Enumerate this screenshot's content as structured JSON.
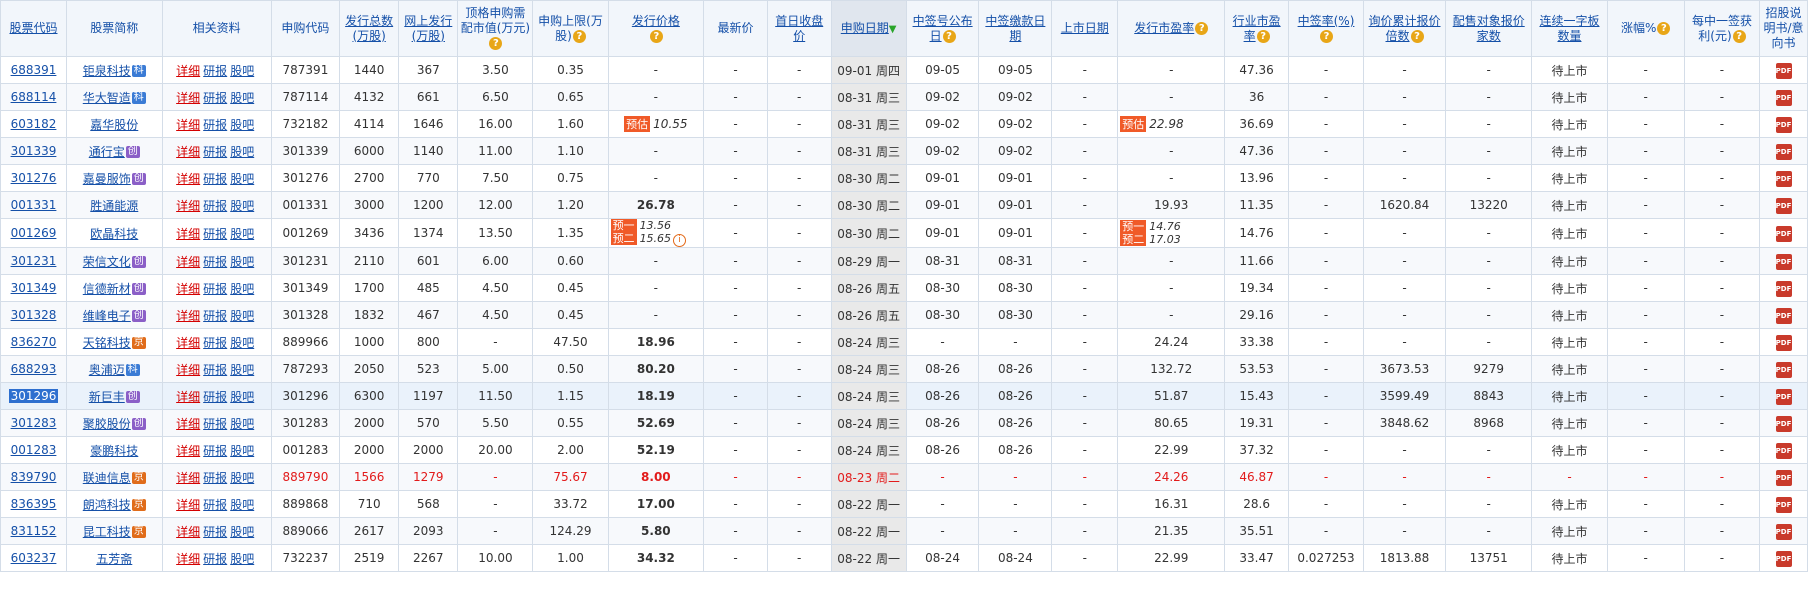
{
  "headers": {
    "code": "股票代码",
    "name": "股票简称",
    "related": "相关资料",
    "sub_code": "申购代码",
    "total_issue": "发行总数(万股)",
    "online_issue": "网上发行(万股)",
    "top_mv": "顶格申购需配市值(万元)",
    "sub_limit": "申购上限(万股)",
    "issue_price": "发行价格",
    "latest_price": "最新价",
    "first_close": "首日收盘价",
    "sub_date": "申购日期",
    "lot_date": "中签号公布日",
    "pay_date": "中签缴款日期",
    "list_date": "上市日期",
    "issue_pe": "发行市盈率",
    "industry_pe": "行业市盈率",
    "win_rate": "中签率(%)",
    "inquiry_multiple": "询价累计报价倍数",
    "alloc_count": "配售对象报价家数",
    "limit_boards": "连续一字板数量",
    "change_pct": "涨幅%",
    "profit_per": "每中一签获利(元)",
    "prospectus": "招股说明书/意向书"
  },
  "links": {
    "detail": "详细",
    "report": "研报",
    "forum": "股吧"
  },
  "badges": {
    "ke": "科",
    "chuang": "创",
    "jing": "京"
  },
  "pdf_label": "PDF",
  "rows": [
    {
      "code": "688391",
      "name": "钜泉科技",
      "badge": "ke",
      "sub_code": "787391",
      "total": "1440",
      "online": "367",
      "top_mv": "3.50",
      "limit": "0.35",
      "price": "-",
      "latest": "-",
      "first": "-",
      "date": "09-01 周四",
      "lot": "09-05",
      "pay": "09-05",
      "list": "-",
      "issue_pe": "-",
      "ind_pe": "47.36",
      "rate": "-",
      "inq": "-",
      "alloc": "-",
      "boards": "待上市",
      "chg": "-",
      "profit": "-"
    },
    {
      "code": "688114",
      "name": "华大智造",
      "badge": "ke",
      "sub_code": "787114",
      "total": "4132",
      "online": "661",
      "top_mv": "6.50",
      "limit": "0.65",
      "price": "-",
      "latest": "-",
      "first": "-",
      "date": "08-31 周三",
      "lot": "09-02",
      "pay": "09-02",
      "list": "-",
      "issue_pe": "-",
      "ind_pe": "36",
      "rate": "-",
      "inq": "-",
      "alloc": "-",
      "boards": "待上市",
      "chg": "-",
      "profit": "-"
    },
    {
      "code": "603182",
      "name": "嘉华股份",
      "badge": "",
      "sub_code": "732182",
      "total": "4114",
      "online": "1646",
      "top_mv": "16.00",
      "limit": "1.60",
      "price": "10.55",
      "price_tag": "预估",
      "latest": "-",
      "first": "-",
      "date": "08-31 周三",
      "lot": "09-02",
      "pay": "09-02",
      "list": "-",
      "issue_pe": "22.98",
      "issue_pe_tag": "预估",
      "ind_pe": "36.69",
      "rate": "-",
      "inq": "-",
      "alloc": "-",
      "boards": "待上市",
      "chg": "-",
      "profit": "-"
    },
    {
      "code": "301339",
      "name": "通行宝",
      "badge": "chuang",
      "sub_code": "301339",
      "total": "6000",
      "online": "1140",
      "top_mv": "11.00",
      "limit": "1.10",
      "price": "-",
      "latest": "-",
      "first": "-",
      "date": "08-31 周三",
      "lot": "09-02",
      "pay": "09-02",
      "list": "-",
      "issue_pe": "-",
      "ind_pe": "47.36",
      "rate": "-",
      "inq": "-",
      "alloc": "-",
      "boards": "待上市",
      "chg": "-",
      "profit": "-"
    },
    {
      "code": "301276",
      "name": "嘉曼服饰",
      "badge": "chuang",
      "sub_code": "301276",
      "total": "2700",
      "online": "770",
      "top_mv": "7.50",
      "limit": "0.75",
      "price": "-",
      "latest": "-",
      "first": "-",
      "date": "08-30 周二",
      "lot": "09-01",
      "pay": "09-01",
      "list": "-",
      "issue_pe": "-",
      "ind_pe": "13.96",
      "rate": "-",
      "inq": "-",
      "alloc": "-",
      "boards": "待上市",
      "chg": "-",
      "profit": "-"
    },
    {
      "code": "001331",
      "name": "胜通能源",
      "badge": "",
      "sub_code": "001331",
      "total": "3000",
      "online": "1200",
      "top_mv": "12.00",
      "limit": "1.20",
      "price": "26.78",
      "price_bold": true,
      "latest": "-",
      "first": "-",
      "date": "08-30 周二",
      "lot": "09-01",
      "pay": "09-01",
      "list": "-",
      "issue_pe": "19.93",
      "ind_pe": "11.35",
      "rate": "-",
      "inq": "1620.84",
      "alloc": "13220",
      "boards": "待上市",
      "chg": "-",
      "profit": "-"
    },
    {
      "code": "001269",
      "name": "欧晶科技",
      "badge": "",
      "sub_code": "001269",
      "total": "3436",
      "online": "1374",
      "top_mv": "13.50",
      "limit": "1.35",
      "price": "",
      "price_multi": [
        "13.56",
        "15.65"
      ],
      "price_tags": [
        "预一",
        "预二"
      ],
      "latest": "-",
      "first": "-",
      "date": "08-30 周二",
      "lot": "09-01",
      "pay": "09-01",
      "list": "-",
      "issue_pe": "",
      "issue_pe_multi": [
        "14.76",
        "17.03"
      ],
      "ind_pe": "14.76",
      "rate": "-",
      "inq": "-",
      "alloc": "-",
      "boards": "待上市",
      "chg": "-",
      "profit": "-"
    },
    {
      "code": "301231",
      "name": "荣信文化",
      "badge": "chuang",
      "sub_code": "301231",
      "total": "2110",
      "online": "601",
      "top_mv": "6.00",
      "limit": "0.60",
      "price": "-",
      "latest": "-",
      "first": "-",
      "date": "08-29 周一",
      "lot": "08-31",
      "pay": "08-31",
      "list": "-",
      "issue_pe": "-",
      "ind_pe": "11.66",
      "rate": "-",
      "inq": "-",
      "alloc": "-",
      "boards": "待上市",
      "chg": "-",
      "profit": "-"
    },
    {
      "code": "301349",
      "name": "信德新材",
      "badge": "chuang",
      "sub_code": "301349",
      "total": "1700",
      "online": "485",
      "top_mv": "4.50",
      "limit": "0.45",
      "price": "-",
      "latest": "-",
      "first": "-",
      "date": "08-26 周五",
      "lot": "08-30",
      "pay": "08-30",
      "list": "-",
      "issue_pe": "-",
      "ind_pe": "19.34",
      "rate": "-",
      "inq": "-",
      "alloc": "-",
      "boards": "待上市",
      "chg": "-",
      "profit": "-"
    },
    {
      "code": "301328",
      "name": "维峰电子",
      "badge": "chuang",
      "sub_code": "301328",
      "total": "1832",
      "online": "467",
      "top_mv": "4.50",
      "limit": "0.45",
      "price": "-",
      "latest": "-",
      "first": "-",
      "date": "08-26 周五",
      "lot": "08-30",
      "pay": "08-30",
      "list": "-",
      "issue_pe": "-",
      "ind_pe": "29.16",
      "rate": "-",
      "inq": "-",
      "alloc": "-",
      "boards": "待上市",
      "chg": "-",
      "profit": "-"
    },
    {
      "code": "836270",
      "name": "天铭科技",
      "badge": "jing",
      "sub_code": "889966",
      "total": "1000",
      "online": "800",
      "top_mv": "-",
      "limit": "47.50",
      "price": "18.96",
      "price_bold": true,
      "latest": "-",
      "first": "-",
      "date": "08-24 周三",
      "lot": "-",
      "pay": "-",
      "list": "-",
      "issue_pe": "24.24",
      "ind_pe": "33.38",
      "rate": "-",
      "inq": "-",
      "alloc": "-",
      "boards": "待上市",
      "chg": "-",
      "profit": "-"
    },
    {
      "code": "688293",
      "name": "奥浦迈",
      "badge": "ke",
      "sub_code": "787293",
      "total": "2050",
      "online": "523",
      "top_mv": "5.00",
      "limit": "0.50",
      "price": "80.20",
      "price_bold": true,
      "latest": "-",
      "first": "-",
      "date": "08-24 周三",
      "lot": "08-26",
      "pay": "08-26",
      "list": "-",
      "issue_pe": "132.72",
      "ind_pe": "53.53",
      "rate": "-",
      "inq": "3673.53",
      "alloc": "9279",
      "boards": "待上市",
      "chg": "-",
      "profit": "-"
    },
    {
      "code": "301296",
      "name": "新巨丰",
      "badge": "chuang",
      "selected": true,
      "sub_code": "301296",
      "total": "6300",
      "online": "1197",
      "top_mv": "11.50",
      "limit": "1.15",
      "price": "18.19",
      "price_bold": true,
      "latest": "-",
      "first": "-",
      "date": "08-24 周三",
      "lot": "08-26",
      "pay": "08-26",
      "list": "-",
      "issue_pe": "51.87",
      "ind_pe": "15.43",
      "rate": "-",
      "inq": "3599.49",
      "alloc": "8843",
      "boards": "待上市",
      "chg": "-",
      "profit": "-"
    },
    {
      "code": "301283",
      "name": "聚胶股份",
      "badge": "chuang",
      "sub_code": "301283",
      "total": "2000",
      "online": "570",
      "top_mv": "5.50",
      "limit": "0.55",
      "price": "52.69",
      "price_bold": true,
      "latest": "-",
      "first": "-",
      "date": "08-24 周三",
      "lot": "08-26",
      "pay": "08-26",
      "list": "-",
      "issue_pe": "80.65",
      "ind_pe": "19.31",
      "rate": "-",
      "inq": "3848.62",
      "alloc": "8968",
      "boards": "待上市",
      "chg": "-",
      "profit": "-"
    },
    {
      "code": "001283",
      "name": "豪鹏科技",
      "badge": "",
      "sub_code": "001283",
      "total": "2000",
      "online": "2000",
      "top_mv": "20.00",
      "limit": "2.00",
      "price": "52.19",
      "price_bold": true,
      "latest": "-",
      "first": "-",
      "date": "08-24 周三",
      "lot": "08-26",
      "pay": "08-26",
      "list": "-",
      "issue_pe": "22.99",
      "ind_pe": "37.32",
      "rate": "-",
      "inq": "-",
      "alloc": "-",
      "boards": "待上市",
      "chg": "-",
      "profit": "-"
    },
    {
      "code": "839790",
      "name": "联迪信息",
      "badge": "jing",
      "red": true,
      "sub_code": "889790",
      "total": "1566",
      "online": "1279",
      "top_mv": "-",
      "limit": "75.67",
      "price": "8.00",
      "price_bold": true,
      "latest": "-",
      "first": "-",
      "date": "08-23 周二",
      "lot": "-",
      "pay": "-",
      "list": "-",
      "issue_pe": "24.26",
      "ind_pe": "46.87",
      "rate": "-",
      "inq": "-",
      "alloc": "-",
      "boards": "-",
      "chg": "-",
      "profit": "-"
    },
    {
      "code": "836395",
      "name": "朗鸿科技",
      "badge": "jing",
      "sub_code": "889868",
      "total": "710",
      "online": "568",
      "top_mv": "-",
      "limit": "33.72",
      "price": "17.00",
      "price_bold": true,
      "latest": "-",
      "first": "-",
      "date": "08-22 周一",
      "lot": "-",
      "pay": "-",
      "list": "-",
      "issue_pe": "16.31",
      "ind_pe": "28.6",
      "rate": "-",
      "inq": "-",
      "alloc": "-",
      "boards": "待上市",
      "chg": "-",
      "profit": "-"
    },
    {
      "code": "831152",
      "name": "昆工科技",
      "badge": "jing",
      "sub_code": "889066",
      "total": "2617",
      "online": "2093",
      "top_mv": "-",
      "limit": "124.29",
      "price": "5.80",
      "price_bold": true,
      "latest": "-",
      "first": "-",
      "date": "08-22 周一",
      "lot": "-",
      "pay": "-",
      "list": "-",
      "issue_pe": "21.35",
      "ind_pe": "35.51",
      "rate": "-",
      "inq": "-",
      "alloc": "-",
      "boards": "待上市",
      "chg": "-",
      "profit": "-"
    },
    {
      "code": "603237",
      "name": "五芳斋",
      "badge": "",
      "sub_code": "732237",
      "total": "2519",
      "online": "2267",
      "top_mv": "10.00",
      "limit": "1.00",
      "price": "34.32",
      "price_bold": true,
      "latest": "-",
      "first": "-",
      "date": "08-22 周一",
      "lot": "08-24",
      "pay": "08-24",
      "list": "-",
      "issue_pe": "22.99",
      "ind_pe": "33.47",
      "rate": "0.027253",
      "inq": "1813.88",
      "alloc": "13751",
      "boards": "待上市",
      "chg": "-",
      "profit": "-"
    }
  ]
}
